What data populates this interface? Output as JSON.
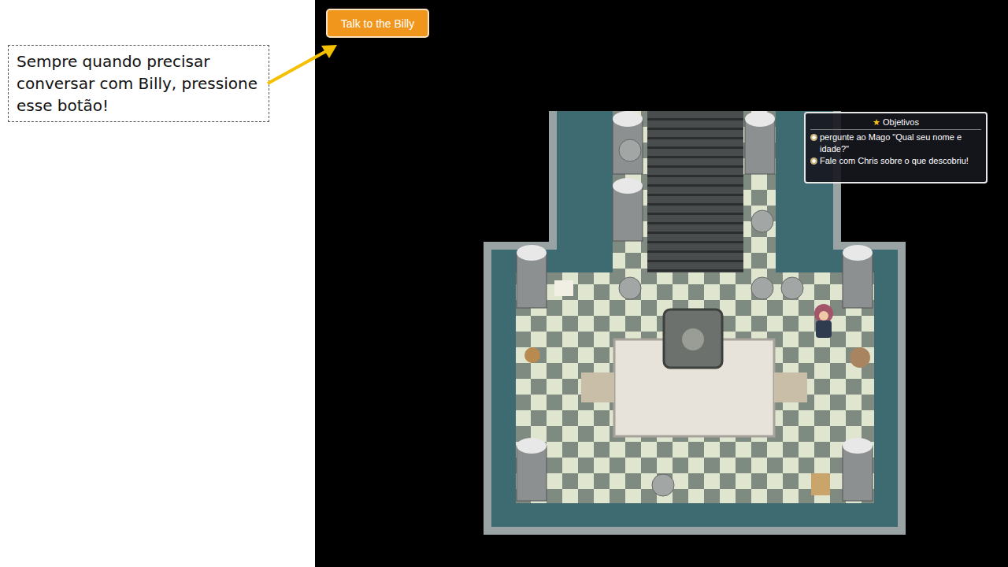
{
  "note": {
    "text": "Sempre quando precisar conversar com Billy, pressione esse botão!"
  },
  "talk_button": {
    "label": "Talk to the Billy"
  },
  "objectives": {
    "star": "★",
    "title": "Objetivos",
    "items": [
      {
        "text": "pergunte ao Mago \"Qual seu nome e idade?\""
      },
      {
        "text": "Fale com Chris sobre o que descobriu!"
      }
    ]
  }
}
